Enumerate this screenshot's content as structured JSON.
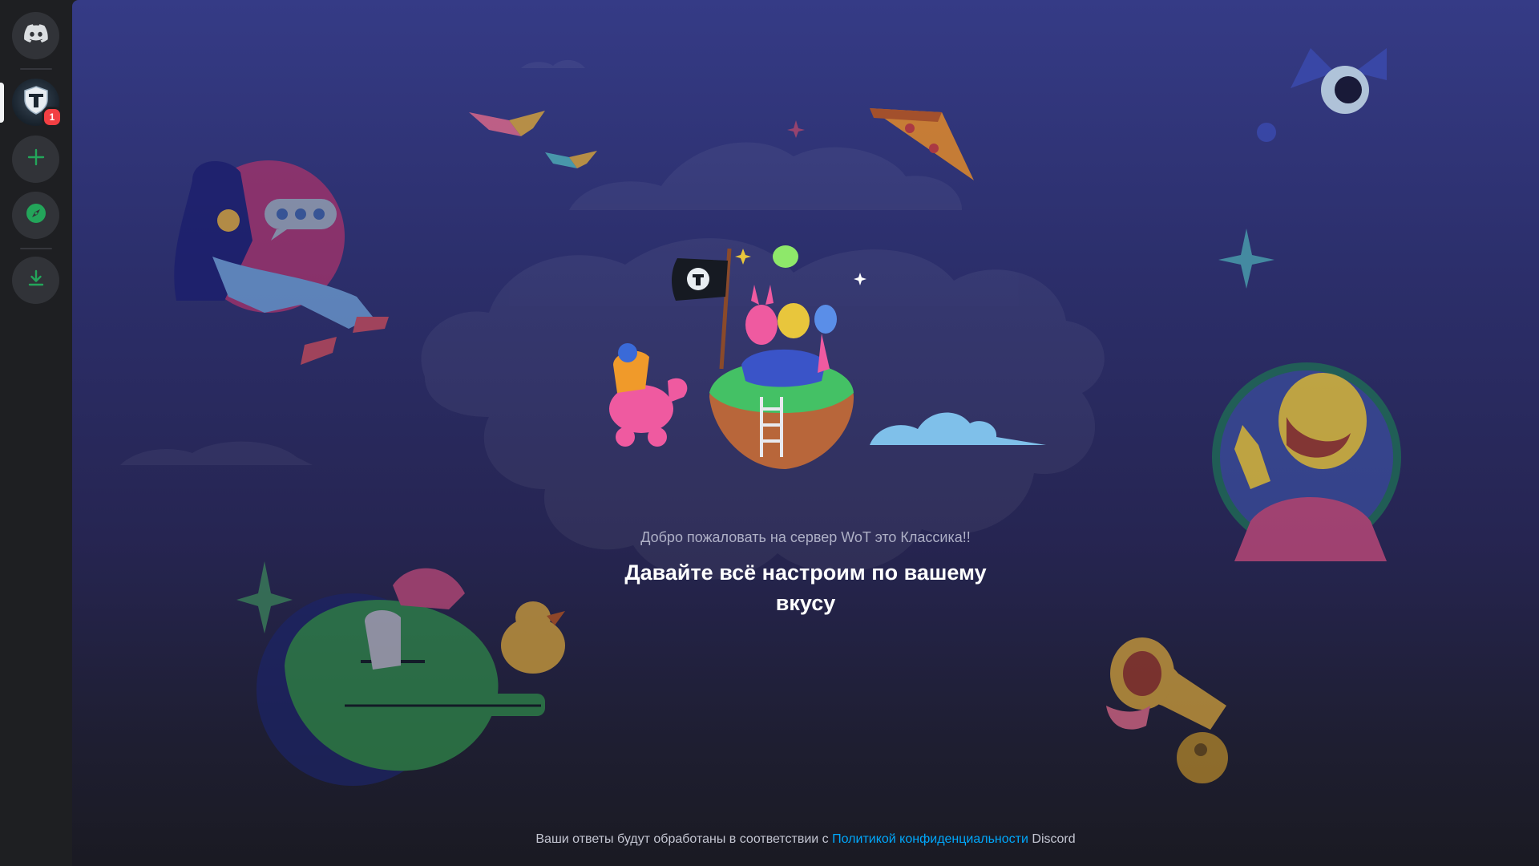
{
  "sidebar": {
    "home": {
      "icon": "discord-logo-icon"
    },
    "server": {
      "name": "WoT это Классика",
      "icon": "wot-tank-emblem-icon",
      "badge": "1"
    },
    "add_server": {
      "icon": "plus-icon"
    },
    "explore": {
      "icon": "compass-icon"
    },
    "download": {
      "icon": "download-icon"
    }
  },
  "welcome": {
    "subtitle": "Добро пожаловать на сервер WoT это Классика!!",
    "title": "Давайте всё настроим по вашему вкусу"
  },
  "footer": {
    "text_before": "Ваши ответы будут обработаны в соответствии с ",
    "link": "Политикой конфиденциальности",
    "text_after": " Discord"
  },
  "colors": {
    "accent_green": "#23a55a",
    "link_blue": "#00a8fc",
    "badge_red": "#f23f43",
    "rail_bg": "#1e1f22",
    "stage_top": "#353b86",
    "stage_bottom": "#1a1a22"
  }
}
